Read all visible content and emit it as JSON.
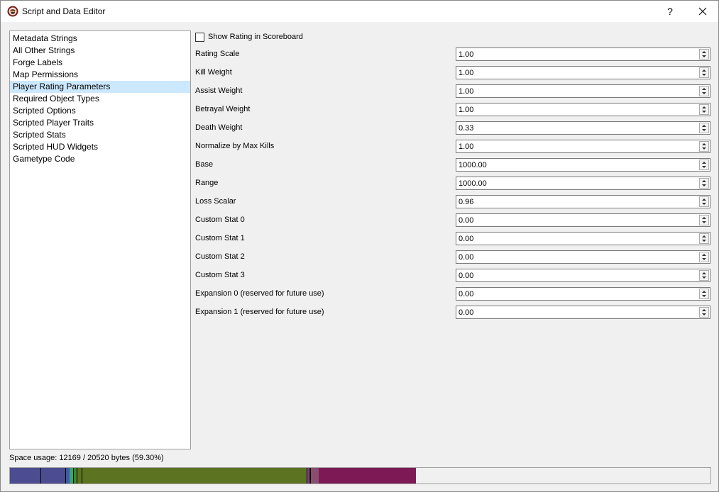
{
  "window": {
    "title": "Script and Data Editor",
    "help_label": "?",
    "icon": "app-icon"
  },
  "sidebar": {
    "items": [
      {
        "label": "Metadata Strings"
      },
      {
        "label": "All Other Strings"
      },
      {
        "label": "Forge Labels"
      },
      {
        "label": "Map Permissions"
      },
      {
        "label": "Player Rating Parameters",
        "selected": true
      },
      {
        "label": "Required Object Types"
      },
      {
        "label": "Scripted Options"
      },
      {
        "label": "Scripted Player Traits"
      },
      {
        "label": "Scripted Stats"
      },
      {
        "label": "Scripted HUD Widgets"
      },
      {
        "label": "Gametype Code"
      }
    ]
  },
  "main": {
    "show_rating_label": "Show Rating in Scoreboard",
    "show_rating_checked": false,
    "params": [
      {
        "label": "Rating Scale",
        "value": "1.00"
      },
      {
        "label": "Kill Weight",
        "value": "1.00"
      },
      {
        "label": "Assist Weight",
        "value": "1.00"
      },
      {
        "label": "Betrayal Weight",
        "value": "1.00"
      },
      {
        "label": "Death Weight",
        "value": "0.33"
      },
      {
        "label": "Normalize by Max Kills",
        "value": "1.00"
      },
      {
        "label": "Base",
        "value": "1000.00"
      },
      {
        "label": "Range",
        "value": "1000.00"
      },
      {
        "label": "Loss Scalar",
        "value": "0.96"
      },
      {
        "label": "Custom Stat 0",
        "value": "0.00"
      },
      {
        "label": "Custom Stat 1",
        "value": "0.00"
      },
      {
        "label": "Custom Stat 2",
        "value": "0.00"
      },
      {
        "label": "Custom Stat 3",
        "value": "0.00"
      },
      {
        "label": "Expansion 0 (reserved for future use)",
        "value": "0.00"
      },
      {
        "label": "Expansion 1 (reserved for future use)",
        "value": "0.00"
      }
    ]
  },
  "footer": {
    "space_usage_label": "Space usage: 12169 / 20520 bytes (59.30%)",
    "usage_fraction": 0.593,
    "segments": [
      {
        "fraction": 0.0787,
        "color": "#4c4c91"
      },
      {
        "fraction": 0.0063,
        "color": "#3f5aa8"
      },
      {
        "fraction": 0.006,
        "color": "#3aa56a"
      },
      {
        "fraction": 0.0035,
        "color": "#2f8e2f"
      },
      {
        "fraction": 0.3281,
        "color": "#5c7421"
      },
      {
        "fraction": 0.0026,
        "color": "#5a3d55"
      },
      {
        "fraction": 0.0152,
        "color": "#8a4d6e"
      },
      {
        "fraction": 0.1395,
        "color": "#7d1a56"
      }
    ],
    "divider_fractions": [
      0.0436,
      0.0787,
      0.09,
      0.0953,
      0.1024,
      0.4265,
      0.4286
    ]
  }
}
